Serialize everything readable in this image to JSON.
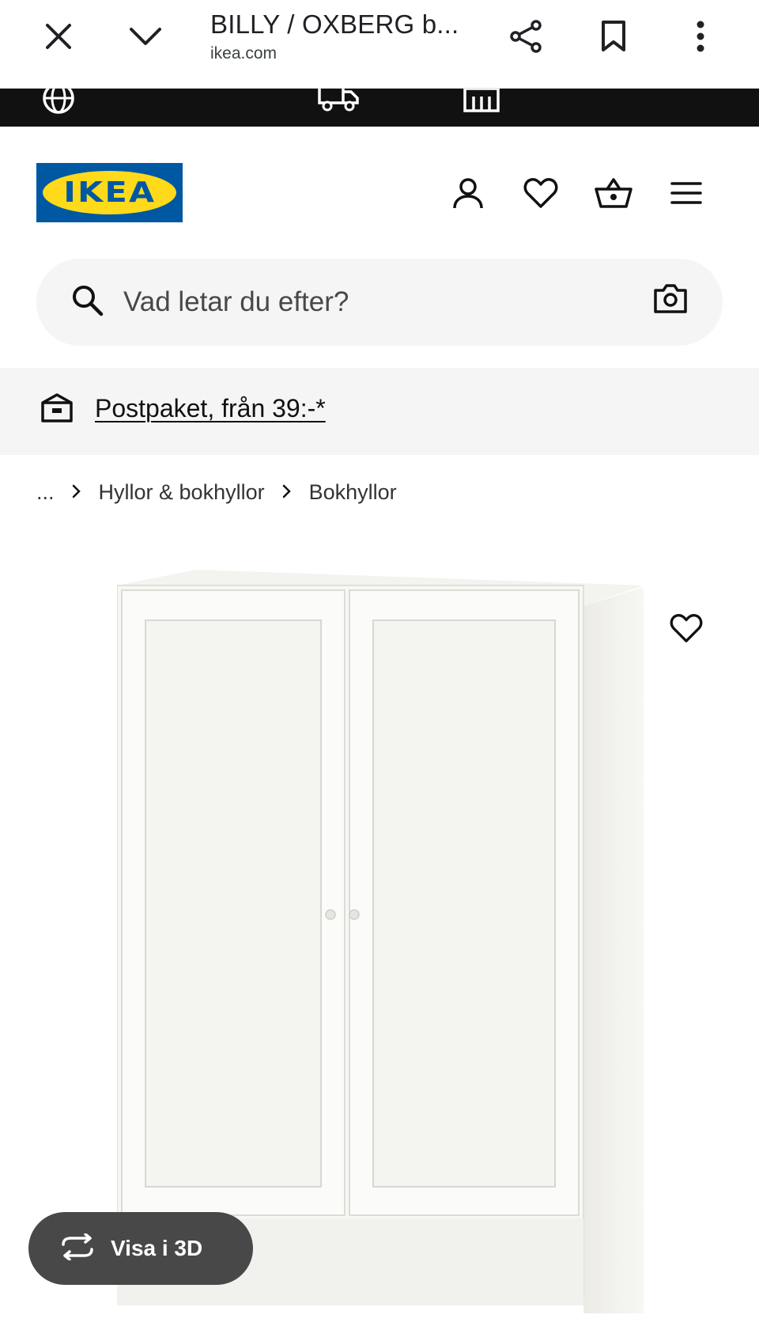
{
  "browser": {
    "title": "BILLY / OXBERG b...",
    "url": "ikea.com",
    "icons": [
      "close-icon",
      "chevron-down-icon",
      "share-icon",
      "bookmark-icon",
      "more-vert-icon"
    ]
  },
  "top_strip": {
    "icons": [
      "globe-icon",
      "delivery-truck-icon",
      "store-icon"
    ]
  },
  "header": {
    "logo_text": "IKEA",
    "icons": [
      "account-icon",
      "heart-icon",
      "basket-icon",
      "menu-icon"
    ],
    "colors": {
      "logo_blue": "#0058a3",
      "logo_yellow": "#ffda1a"
    }
  },
  "search": {
    "placeholder": "Vad letar du efter?",
    "icons": [
      "search-icon",
      "camera-icon"
    ]
  },
  "banner": {
    "link_text": "Postpaket, från 39:-*",
    "icon": "parcel-icon"
  },
  "breadcrumb": {
    "ellipsis": "...",
    "items": [
      "Hyllor & bokhyllor",
      "Bokhyllor"
    ]
  },
  "product": {
    "favorite_icon": "heart-icon",
    "view3d_label": "Visa i 3D",
    "view3d_icon": "rotate-3d-icon"
  }
}
